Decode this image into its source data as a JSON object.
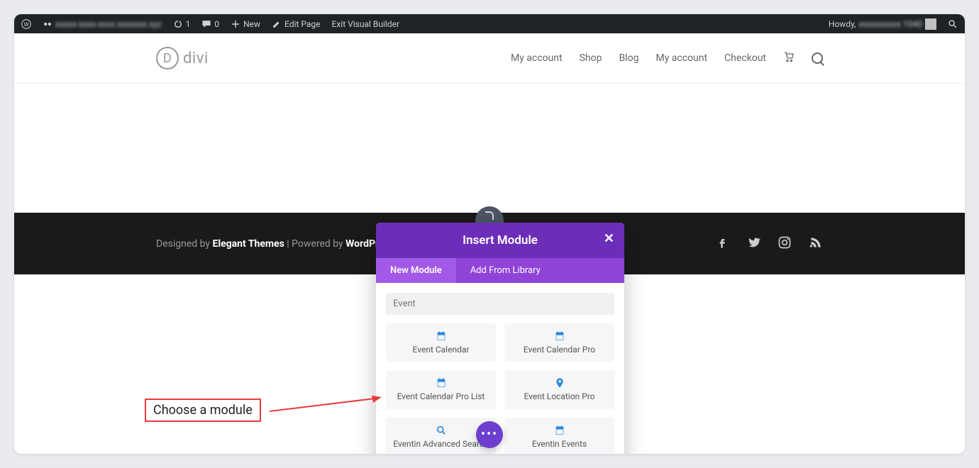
{
  "adminbar": {
    "refresh_count": "1",
    "comment_count": "0",
    "new_label": "New",
    "edit_page": "Edit Page",
    "exit_builder": "Exit Visual Builder",
    "howdy": "Howdy,"
  },
  "header": {
    "logo_text": "divi",
    "nav": [
      "My account",
      "Shop",
      "Blog",
      "My account",
      "Checkout"
    ]
  },
  "footer": {
    "designed": "Designed by ",
    "elegant": "Elegant Themes",
    "sep": " | Powered by ",
    "wp": "WordPress"
  },
  "modal": {
    "title": "Insert Module",
    "tab_new": "New Module",
    "tab_lib": "Add From Library",
    "search_value": "Event",
    "modules": [
      {
        "name": "Event Calendar",
        "icon": "cal"
      },
      {
        "name": "Event Calendar Pro",
        "icon": "cal"
      },
      {
        "name": "Event Calendar Pro List",
        "icon": "cal"
      },
      {
        "name": "Event Location Pro",
        "icon": "pin"
      },
      {
        "name": "Eventin Advanced Search",
        "icon": "search"
      },
      {
        "name": "Eventin Events",
        "icon": "cal"
      }
    ]
  },
  "annotation": {
    "text": "Choose a module"
  }
}
